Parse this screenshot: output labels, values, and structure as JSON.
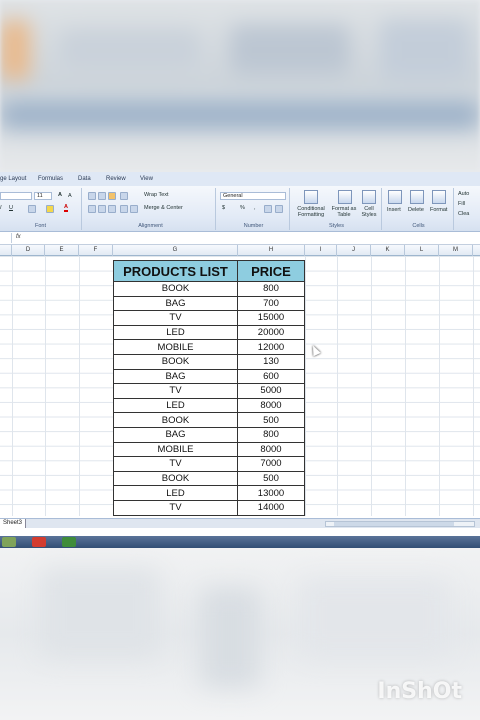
{
  "ribbon": {
    "tabs": [
      "ge Layout",
      "Formulas",
      "Data",
      "Review",
      "View"
    ],
    "font_name": "",
    "font_size": "11",
    "wrap_text_label": "Wrap Text",
    "merge_center_label": "Merge & Center",
    "number_format": "General",
    "currency_symbol": "$",
    "percent_symbol": "%",
    "comma_symbol": ",",
    "conditional_formatting_label": "Conditional Formatting",
    "format_as_table_label": "Format as Table",
    "cell_styles_label": "Cell Styles",
    "insert_label": "Insert",
    "delete_label": "Delete",
    "format_label": "Format",
    "auto_label": "Auto",
    "fill_label": "Fill",
    "clear_label": "Clea",
    "groups": [
      "Font",
      "Alignment",
      "Number",
      "Styles",
      "Cells"
    ]
  },
  "formula_bar": {
    "fx": "fx",
    "value": ""
  },
  "columns": [
    "D",
    "E",
    "F",
    "G",
    "H",
    "I",
    "J",
    "K",
    "L",
    "M"
  ],
  "table": {
    "headers": [
      "PRODUCTS LIST",
      "PRICE"
    ],
    "rows": [
      [
        "BOOK",
        "800"
      ],
      [
        "BAG",
        "700"
      ],
      [
        "TV",
        "15000"
      ],
      [
        "LED",
        "20000"
      ],
      [
        "MOBILE",
        "12000"
      ],
      [
        "BOOK",
        "130"
      ],
      [
        "BAG",
        "600"
      ],
      [
        "TV",
        "5000"
      ],
      [
        "LED",
        "8000"
      ],
      [
        "BOOK",
        "500"
      ],
      [
        "BAG",
        "800"
      ],
      [
        "MOBILE",
        "8000"
      ],
      [
        "TV",
        "7000"
      ],
      [
        "BOOK",
        "500"
      ],
      [
        "LED",
        "13000"
      ],
      [
        "TV",
        "14000"
      ]
    ]
  },
  "sheet_tab": "Sheet3",
  "watermark": "InShOt",
  "colors": {
    "header_fill": "#8ecde0",
    "ribbon": "#dfe8f5"
  }
}
